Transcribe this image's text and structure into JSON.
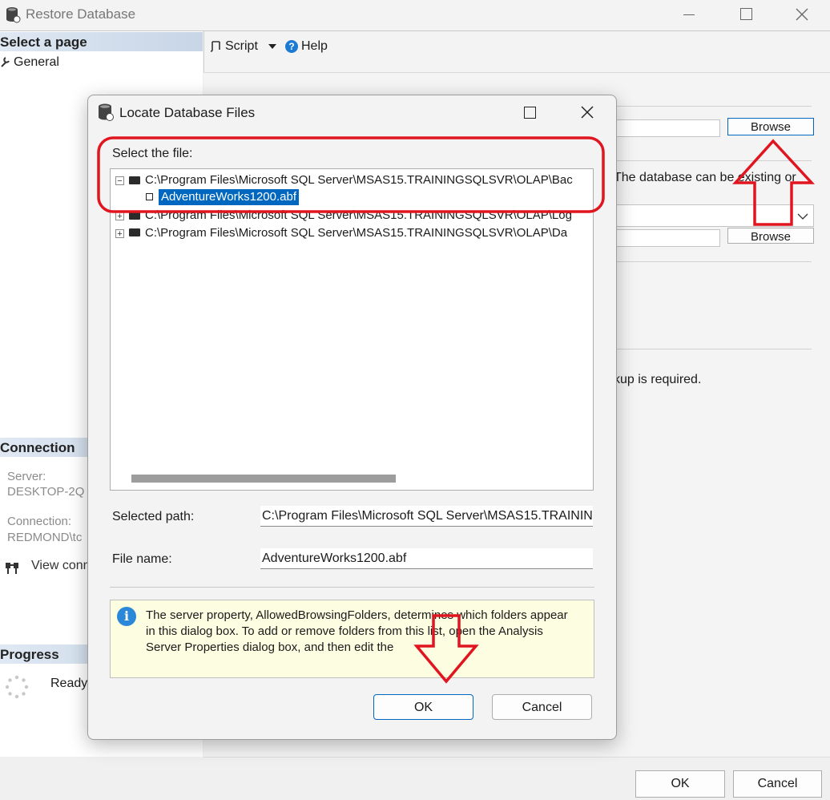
{
  "outer": {
    "title": "Restore Database",
    "sidebar": {
      "select_page": "Select a page",
      "general": "General",
      "connection_heading": "Connection",
      "server_label": "Server:",
      "server_value": "DESKTOP-2Q",
      "connection_label": "Connection:",
      "connection_value": "REDMOND\\tc",
      "view_connection": "View conn",
      "progress_heading": "Progress",
      "progress_status": "Ready"
    },
    "toolbar": {
      "script": "Script",
      "help": "Help"
    },
    "main": {
      "browse1": "Browse",
      "browse2": "Browse",
      "note1": "The database can be existing or",
      "note2": "kup is required."
    },
    "buttons": {
      "ok": "OK",
      "cancel": "Cancel"
    }
  },
  "dialog": {
    "title": "Locate Database Files",
    "select_label": "Select the file:",
    "tree": [
      {
        "path": "C:\\Program Files\\Microsoft SQL Server\\MSAS15.TRAININGSQLSVR\\OLAP\\Bac",
        "expanded": true
      },
      {
        "path": "AdventureWorks1200.abf",
        "selected": true
      },
      {
        "path": "C:\\Program Files\\Microsoft SQL Server\\MSAS15.TRAININGSQLSVR\\OLAP\\Log",
        "expanded": false
      },
      {
        "path": "C:\\Program Files\\Microsoft SQL Server\\MSAS15.TRAININGSQLSVR\\OLAP\\Da",
        "expanded": false
      }
    ],
    "selected_path_label": "Selected path:",
    "selected_path_value": "C:\\Program Files\\Microsoft SQL Server\\MSAS15.TRAININC",
    "file_name_label": "File name:",
    "file_name_value": "AdventureWorks1200.abf",
    "info": "The server property, AllowedBrowsingFolders, determines which folders appear in this dialog box. To add or remove folders from this list, open the Analysis Server Properties dialog box, and then edit the",
    "ok": "OK",
    "cancel": "Cancel"
  },
  "colors": {
    "annotation": "#e0151f",
    "selection": "#0067c0"
  }
}
